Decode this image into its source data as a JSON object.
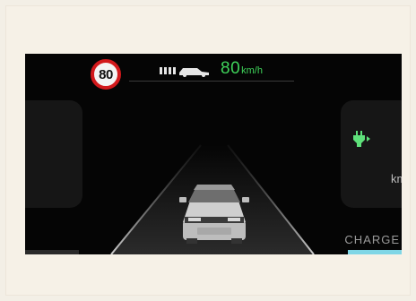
{
  "hud": {
    "speed_limit": "80",
    "set_speed_value": "80",
    "set_speed_unit": "km/h",
    "right_panel_unit": "km",
    "charge_label": "CHARGE"
  },
  "icons": [
    "speed-limit-sign",
    "vehicle-follow-distance-icon",
    "charging-plug-icon"
  ],
  "colors": {
    "set_speed": "#3fd35a",
    "speed_limit_ring": "#d2191c",
    "charge_bar": "#7fd6e6",
    "screen_bg": "#050505"
  }
}
